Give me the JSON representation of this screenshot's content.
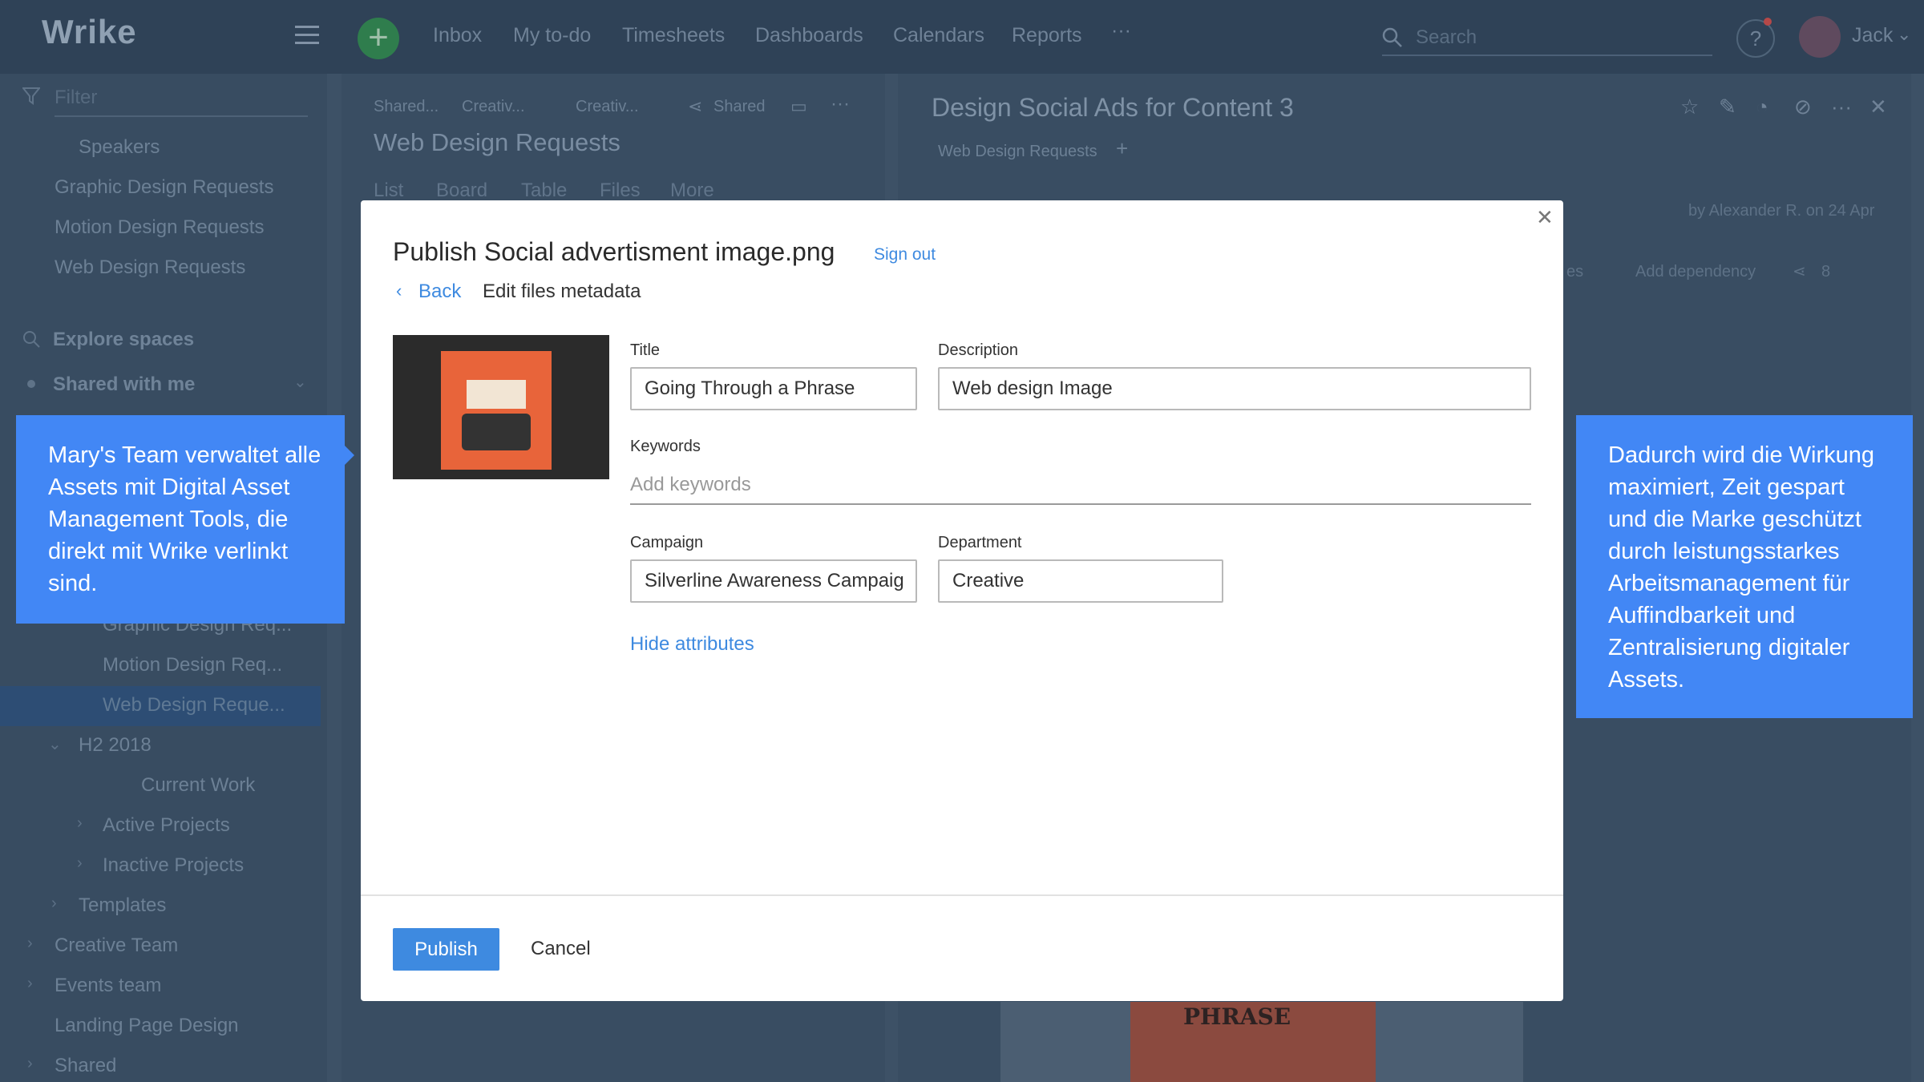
{
  "app": {
    "logo": "Wrike"
  },
  "topnav": {
    "add": "+",
    "items": [
      "Inbox",
      "My to-do",
      "Timesheets",
      "Dashboards",
      "Calendars",
      "Reports"
    ],
    "more": "···",
    "search_placeholder": "Search",
    "help": "?",
    "user_name": "Jack"
  },
  "sidebar": {
    "filter_placeholder": "Filter",
    "items": [
      "Speakers",
      "Graphic Design Requests",
      "Motion Design Requests",
      "Web Design Requests",
      "Explore spaces",
      "Shared with me",
      "Graphic Design Req...",
      "Motion Design Req...",
      "Web Design Reque...",
      "H2 2018",
      "Current Work",
      "Active Projects",
      "Inactive Projects",
      "Templates",
      "Creative Team",
      "Events team",
      "Landing Page Design",
      "Shared"
    ]
  },
  "left_panel": {
    "breadcrumbs": [
      "Shared...",
      "Creativ...",
      "Creativ..."
    ],
    "shared_label": "Shared",
    "title": "Web Design Requests",
    "tabs": [
      "List",
      "Board",
      "Table",
      "Files",
      "More"
    ]
  },
  "right_panel": {
    "title": "Design Social Ads for Content 3",
    "folder_tag": "Web Design Requests",
    "author_line": "by Alexander R. on 24 Apr",
    "partial_text": "es",
    "add_dependency": "Add dependency",
    "share_count": "8",
    "image_text": "PHRASE"
  },
  "modal": {
    "title": "Publish Social advertisment image.png",
    "sign_out": "Sign out",
    "back": "Back",
    "subtitle": "Edit files metadata",
    "fields": {
      "title_label": "Title",
      "title_value": "Going Through a Phrase",
      "description_label": "Description",
      "description_value": "Web design Image",
      "keywords_label": "Keywords",
      "keywords_placeholder": "Add keywords",
      "campaign_label": "Campaign",
      "campaign_value": "Silverline Awareness Campaig",
      "department_label": "Department",
      "department_value": "Creative"
    },
    "hide_attributes": "Hide attributes",
    "publish": "Publish",
    "cancel": "Cancel"
  },
  "callouts": {
    "left": "Mary's Team verwaltet alle Assets mit Digital Asset Management Tools, die direkt mit Wrike verlinkt sind.",
    "right": "Dadurch wird die Wirkung maximiert, Zeit gespart und die Marke geschützt durch leistungsstarkes Arbeitsmanagement für Auffindbarkeit und Zentralisierung digitaler Assets."
  },
  "colors": {
    "accent": "#4287f5",
    "link": "#3e8ae0",
    "overlay_bg": "#3d5166"
  }
}
